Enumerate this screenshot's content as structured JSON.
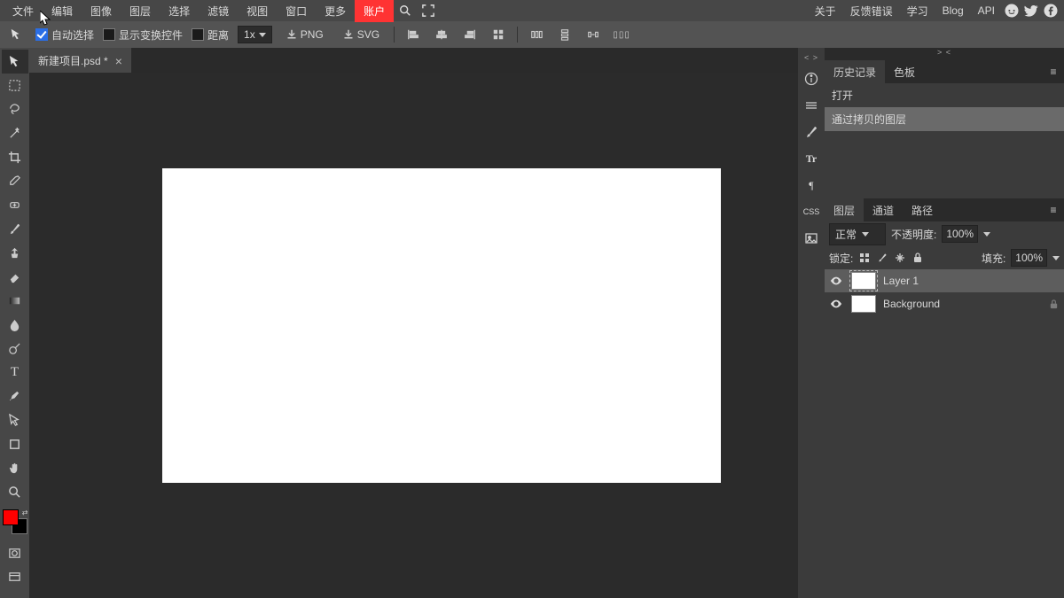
{
  "menubar": {
    "items": [
      "文件",
      "编辑",
      "图像",
      "图层",
      "选择",
      "滤镜",
      "视图",
      "窗口",
      "更多"
    ],
    "account": "账户",
    "right": [
      "关于",
      "反馈错误",
      "学习",
      "Blog",
      "API"
    ]
  },
  "optionbar": {
    "auto_select": "自动选择",
    "show_transform": "显示变换控件",
    "distance": "距离",
    "zoom": "1x",
    "png": "PNG",
    "svg": "SVG"
  },
  "doc_tab": {
    "title": "新建项目.psd *"
  },
  "dock_right_top": "<  >",
  "dock_right_top2": ">  <",
  "history_panel": {
    "tabs": [
      "历史记录",
      "色板"
    ],
    "items": [
      "打开",
      "通过拷贝的图层"
    ]
  },
  "layers_panel": {
    "tabs": [
      "图层",
      "通道",
      "路径"
    ],
    "blend": "正常",
    "opacity_label": "不透明度:",
    "opacity_value": "100%",
    "lock_label": "锁定:",
    "fill_label": "填充:",
    "fill_value": "100%",
    "layers": [
      {
        "name": "Layer 1",
        "selected": true,
        "dashed": true,
        "locked": false
      },
      {
        "name": "Background",
        "selected": false,
        "dashed": false,
        "locked": true
      }
    ]
  },
  "colors": {
    "fg": "#ff0000",
    "bg": "#000000"
  }
}
